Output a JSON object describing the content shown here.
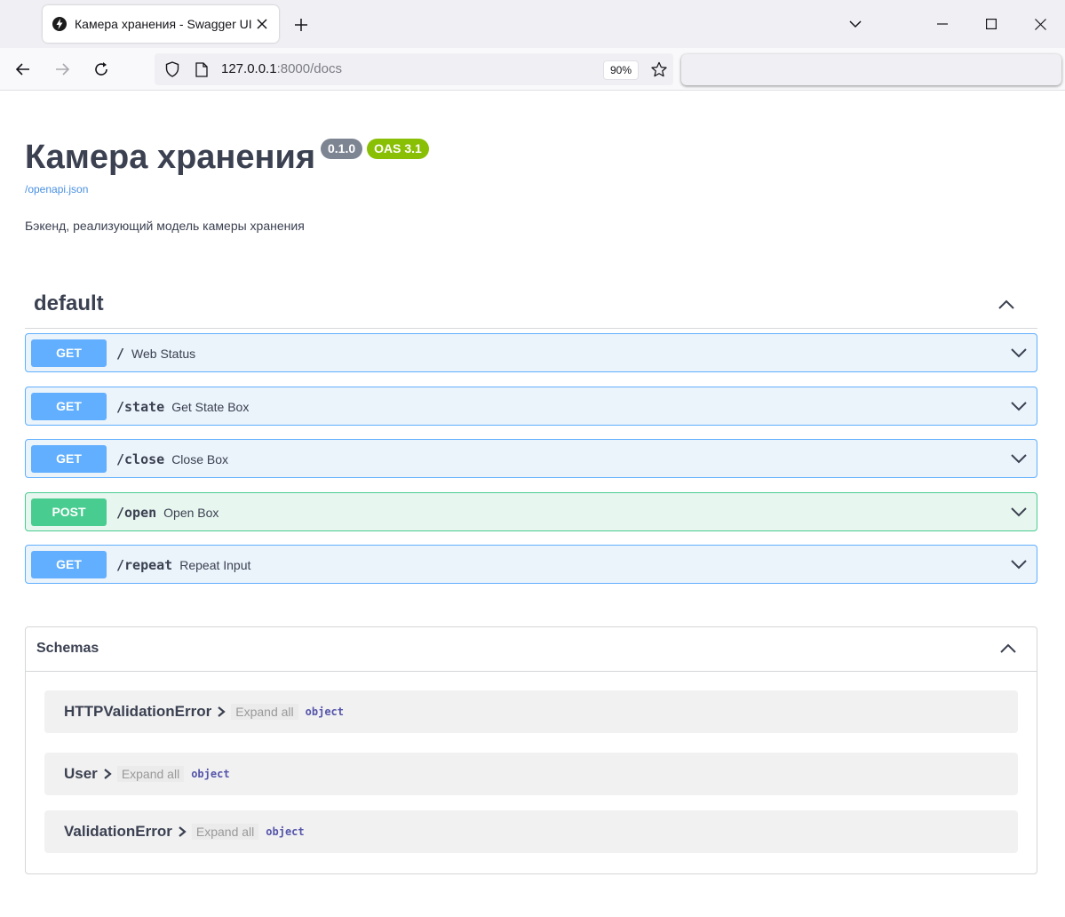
{
  "browser": {
    "tab_title": "Камера хранения - Swagger UI",
    "url_host": "127.0.0.1",
    "url_rest": ":8000/docs",
    "zoom": "90%"
  },
  "api": {
    "title": "Камера хранения",
    "version": "0.1.0",
    "oas": "OAS 3.1",
    "spec_link": "/openapi.json",
    "description": "Бэкенд, реализующий модель камеры хранения"
  },
  "tag": {
    "name": "default"
  },
  "operations": [
    {
      "method": "GET",
      "path": "/",
      "summary": "Web Status"
    },
    {
      "method": "GET",
      "path": "/state",
      "summary": "Get State Box"
    },
    {
      "method": "GET",
      "path": "/close",
      "summary": "Close Box"
    },
    {
      "method": "POST",
      "path": "/open",
      "summary": "Open Box"
    },
    {
      "method": "GET",
      "path": "/repeat",
      "summary": "Repeat Input"
    }
  ],
  "schemas": {
    "title": "Schemas",
    "models": [
      {
        "name": "HTTPValidationError",
        "expand": "Expand all",
        "type": "object"
      },
      {
        "name": "User",
        "expand": "Expand all",
        "type": "object"
      },
      {
        "name": "ValidationError",
        "expand": "Expand all",
        "type": "object"
      }
    ]
  },
  "colors": {
    "get": "#61affe",
    "post": "#49cc90",
    "oas_badge": "#89bf04",
    "version_badge": "#7d8492"
  }
}
